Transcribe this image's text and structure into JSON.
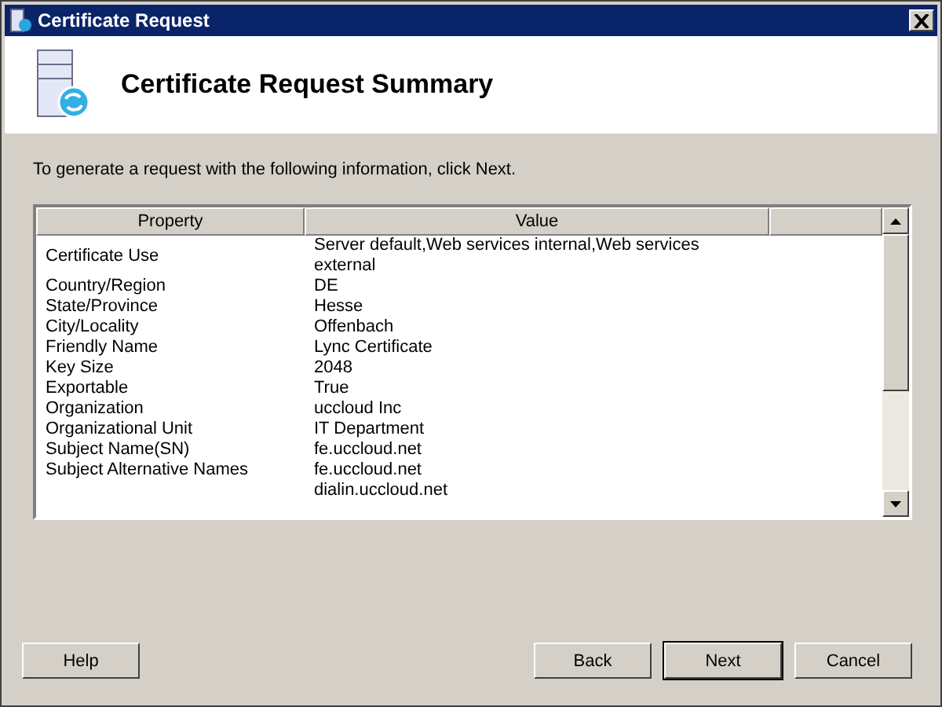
{
  "window": {
    "title": "Certificate Request"
  },
  "header": {
    "title": "Certificate Request Summary"
  },
  "instruction": "To generate a request with the following information, click Next.",
  "table": {
    "columns": [
      "Property",
      "Value"
    ],
    "rows": [
      {
        "property": "Certificate Use",
        "values": [
          "Server default,Web services internal,Web services external"
        ]
      },
      {
        "property": "Country/Region",
        "values": [
          "DE"
        ]
      },
      {
        "property": "State/Province",
        "values": [
          "Hesse"
        ]
      },
      {
        "property": "City/Locality",
        "values": [
          "Offenbach"
        ]
      },
      {
        "property": "Friendly Name",
        "values": [
          "Lync Certificate"
        ]
      },
      {
        "property": "Key Size",
        "values": [
          "2048"
        ]
      },
      {
        "property": "Exportable",
        "values": [
          "True"
        ]
      },
      {
        "property": "Organization",
        "values": [
          "uccloud Inc"
        ]
      },
      {
        "property": "Organizational Unit",
        "values": [
          "IT Department"
        ]
      },
      {
        "property": "Subject Name(SN)",
        "values": [
          "fe.uccloud.net"
        ]
      },
      {
        "property": "Subject Alternative Names",
        "values": [
          "fe.uccloud.net",
          "dialin.uccloud.net"
        ]
      }
    ]
  },
  "left_buttons": [
    {
      "label": "Help",
      "default": false
    }
  ],
  "right_buttons": [
    {
      "label": "Back",
      "default": false
    },
    {
      "label": "Next",
      "default": true
    },
    {
      "label": "Cancel",
      "default": false
    }
  ]
}
